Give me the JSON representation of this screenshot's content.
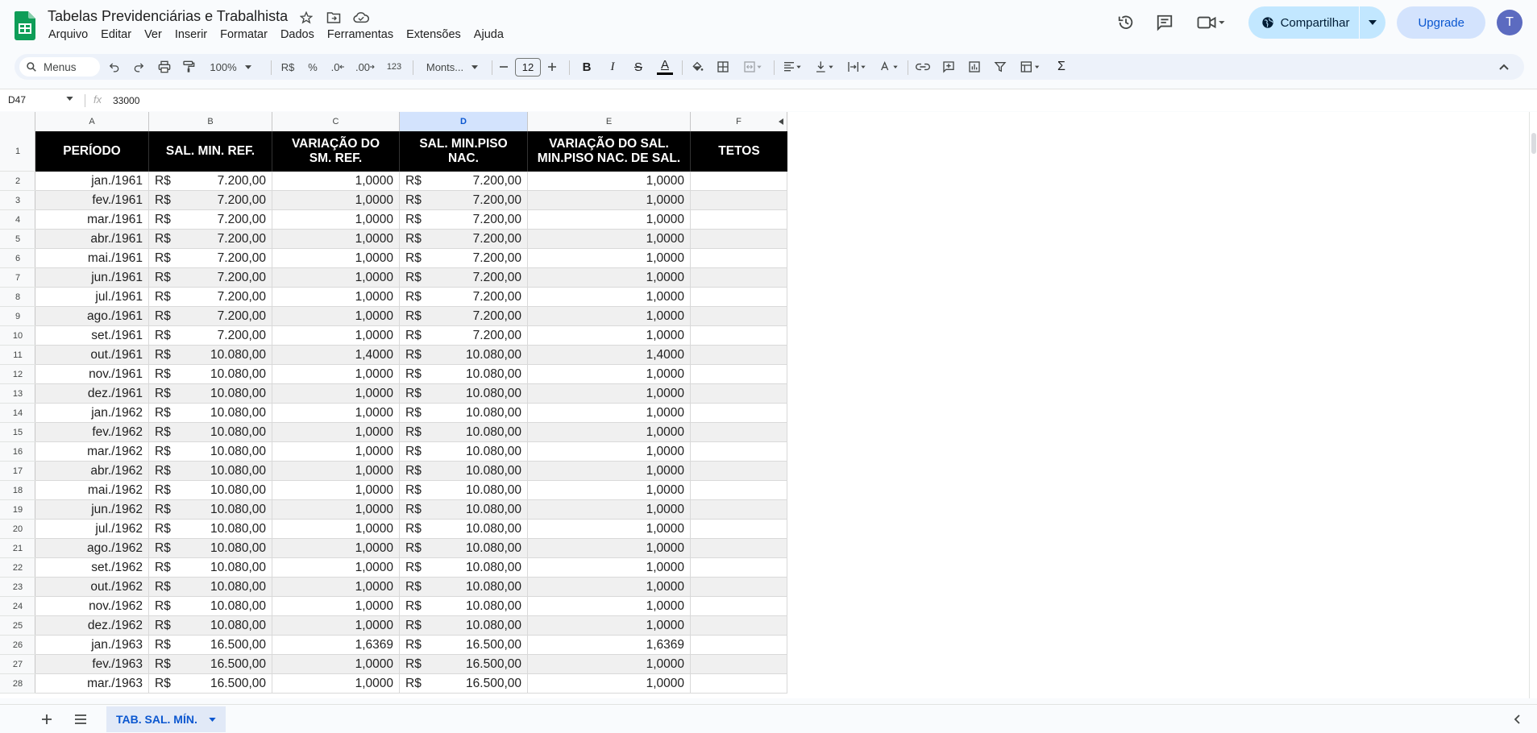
{
  "doc": {
    "title": "Tabelas Previdenciárias e Trabalhista"
  },
  "menu": [
    "Arquivo",
    "Editar",
    "Ver",
    "Inserir",
    "Formatar",
    "Dados",
    "Ferramentas",
    "Extensões",
    "Ajuda"
  ],
  "header_actions": {
    "share_label": "Compartilhar",
    "upgrade_label": "Upgrade",
    "avatar_letter": "T"
  },
  "toolbar": {
    "search_label": "Menus",
    "zoom": "100%",
    "currency": "R$",
    "percent": "%",
    "dec_decrease": ".0",
    "dec_increase": ".00",
    "number_format": "123",
    "font": "Monts...",
    "font_size": "12",
    "bold": "B",
    "italic": "I",
    "strike": "S",
    "text_color": "A",
    "text_color_swatch": "#000000",
    "function": "Σ"
  },
  "formula_bar": {
    "cell_ref": "D47",
    "fx": "fx",
    "value": "33000"
  },
  "columns": [
    "A",
    "B",
    "C",
    "D",
    "E",
    "F"
  ],
  "selected_column": "D",
  "header_row": {
    "row_number": "1",
    "a": "PERÍODO",
    "b": "SAL. MIN. REF.",
    "c1": "VARIAÇÃO DO",
    "c2": "SM. REF.",
    "d1": "SAL. MIN.PISO",
    "d2": "NAC.",
    "e1": "VARIAÇÃO DO SAL.",
    "e2": "MIN.PISO NAC. DE SAL.",
    "f": "TETOS"
  },
  "rows": [
    {
      "n": "2",
      "a": "jan./1961",
      "b_cur": "R$",
      "b": "7.200,00",
      "c": "1,0000",
      "d_cur": "R$",
      "d": "7.200,00",
      "e": "1,0000"
    },
    {
      "n": "3",
      "a": "fev./1961",
      "b_cur": "R$",
      "b": "7.200,00",
      "c": "1,0000",
      "d_cur": "R$",
      "d": "7.200,00",
      "e": "1,0000"
    },
    {
      "n": "4",
      "a": "mar./1961",
      "b_cur": "R$",
      "b": "7.200,00",
      "c": "1,0000",
      "d_cur": "R$",
      "d": "7.200,00",
      "e": "1,0000"
    },
    {
      "n": "5",
      "a": "abr./1961",
      "b_cur": "R$",
      "b": "7.200,00",
      "c": "1,0000",
      "d_cur": "R$",
      "d": "7.200,00",
      "e": "1,0000"
    },
    {
      "n": "6",
      "a": "mai./1961",
      "b_cur": "R$",
      "b": "7.200,00",
      "c": "1,0000",
      "d_cur": "R$",
      "d": "7.200,00",
      "e": "1,0000"
    },
    {
      "n": "7",
      "a": "jun./1961",
      "b_cur": "R$",
      "b": "7.200,00",
      "c": "1,0000",
      "d_cur": "R$",
      "d": "7.200,00",
      "e": "1,0000"
    },
    {
      "n": "8",
      "a": "jul./1961",
      "b_cur": "R$",
      "b": "7.200,00",
      "c": "1,0000",
      "d_cur": "R$",
      "d": "7.200,00",
      "e": "1,0000"
    },
    {
      "n": "9",
      "a": "ago./1961",
      "b_cur": "R$",
      "b": "7.200,00",
      "c": "1,0000",
      "d_cur": "R$",
      "d": "7.200,00",
      "e": "1,0000"
    },
    {
      "n": "10",
      "a": "set./1961",
      "b_cur": "R$",
      "b": "7.200,00",
      "c": "1,0000",
      "d_cur": "R$",
      "d": "7.200,00",
      "e": "1,0000"
    },
    {
      "n": "11",
      "a": "out./1961",
      "b_cur": "R$",
      "b": "10.080,00",
      "c": "1,4000",
      "d_cur": "R$",
      "d": "10.080,00",
      "e": "1,4000"
    },
    {
      "n": "12",
      "a": "nov./1961",
      "b_cur": "R$",
      "b": "10.080,00",
      "c": "1,0000",
      "d_cur": "R$",
      "d": "10.080,00",
      "e": "1,0000"
    },
    {
      "n": "13",
      "a": "dez./1961",
      "b_cur": "R$",
      "b": "10.080,00",
      "c": "1,0000",
      "d_cur": "R$",
      "d": "10.080,00",
      "e": "1,0000"
    },
    {
      "n": "14",
      "a": "jan./1962",
      "b_cur": "R$",
      "b": "10.080,00",
      "c": "1,0000",
      "d_cur": "R$",
      "d": "10.080,00",
      "e": "1,0000"
    },
    {
      "n": "15",
      "a": "fev./1962",
      "b_cur": "R$",
      "b": "10.080,00",
      "c": "1,0000",
      "d_cur": "R$",
      "d": "10.080,00",
      "e": "1,0000"
    },
    {
      "n": "16",
      "a": "mar./1962",
      "b_cur": "R$",
      "b": "10.080,00",
      "c": "1,0000",
      "d_cur": "R$",
      "d": "10.080,00",
      "e": "1,0000"
    },
    {
      "n": "17",
      "a": "abr./1962",
      "b_cur": "R$",
      "b": "10.080,00",
      "c": "1,0000",
      "d_cur": "R$",
      "d": "10.080,00",
      "e": "1,0000"
    },
    {
      "n": "18",
      "a": "mai./1962",
      "b_cur": "R$",
      "b": "10.080,00",
      "c": "1,0000",
      "d_cur": "R$",
      "d": "10.080,00",
      "e": "1,0000"
    },
    {
      "n": "19",
      "a": "jun./1962",
      "b_cur": "R$",
      "b": "10.080,00",
      "c": "1,0000",
      "d_cur": "R$",
      "d": "10.080,00",
      "e": "1,0000"
    },
    {
      "n": "20",
      "a": "jul./1962",
      "b_cur": "R$",
      "b": "10.080,00",
      "c": "1,0000",
      "d_cur": "R$",
      "d": "10.080,00",
      "e": "1,0000"
    },
    {
      "n": "21",
      "a": "ago./1962",
      "b_cur": "R$",
      "b": "10.080,00",
      "c": "1,0000",
      "d_cur": "R$",
      "d": "10.080,00",
      "e": "1,0000"
    },
    {
      "n": "22",
      "a": "set./1962",
      "b_cur": "R$",
      "b": "10.080,00",
      "c": "1,0000",
      "d_cur": "R$",
      "d": "10.080,00",
      "e": "1,0000"
    },
    {
      "n": "23",
      "a": "out./1962",
      "b_cur": "R$",
      "b": "10.080,00",
      "c": "1,0000",
      "d_cur": "R$",
      "d": "10.080,00",
      "e": "1,0000"
    },
    {
      "n": "24",
      "a": "nov./1962",
      "b_cur": "R$",
      "b": "10.080,00",
      "c": "1,0000",
      "d_cur": "R$",
      "d": "10.080,00",
      "e": "1,0000"
    },
    {
      "n": "25",
      "a": "dez./1962",
      "b_cur": "R$",
      "b": "10.080,00",
      "c": "1,0000",
      "d_cur": "R$",
      "d": "10.080,00",
      "e": "1,0000"
    },
    {
      "n": "26",
      "a": "jan./1963",
      "b_cur": "R$",
      "b": "16.500,00",
      "c": "1,6369",
      "d_cur": "R$",
      "d": "16.500,00",
      "e": "1,6369"
    },
    {
      "n": "27",
      "a": "fev./1963",
      "b_cur": "R$",
      "b": "16.500,00",
      "c": "1,0000",
      "d_cur": "R$",
      "d": "16.500,00",
      "e": "1,0000"
    },
    {
      "n": "28",
      "a": "mar./1963",
      "b_cur": "R$",
      "b": "16.500,00",
      "c": "1,0000",
      "d_cur": "R$",
      "d": "16.500,00",
      "e": "1,0000"
    }
  ],
  "sheet_tabs": [
    {
      "label": "TAB. SAL. MÍN.",
      "active": true
    }
  ],
  "colors": {
    "accent": "#0b57d0",
    "share_bg": "#c2e7ff",
    "header_bg": "#000000",
    "stripe": "#f0f0f0",
    "sheets_green": "#0f9d58"
  }
}
